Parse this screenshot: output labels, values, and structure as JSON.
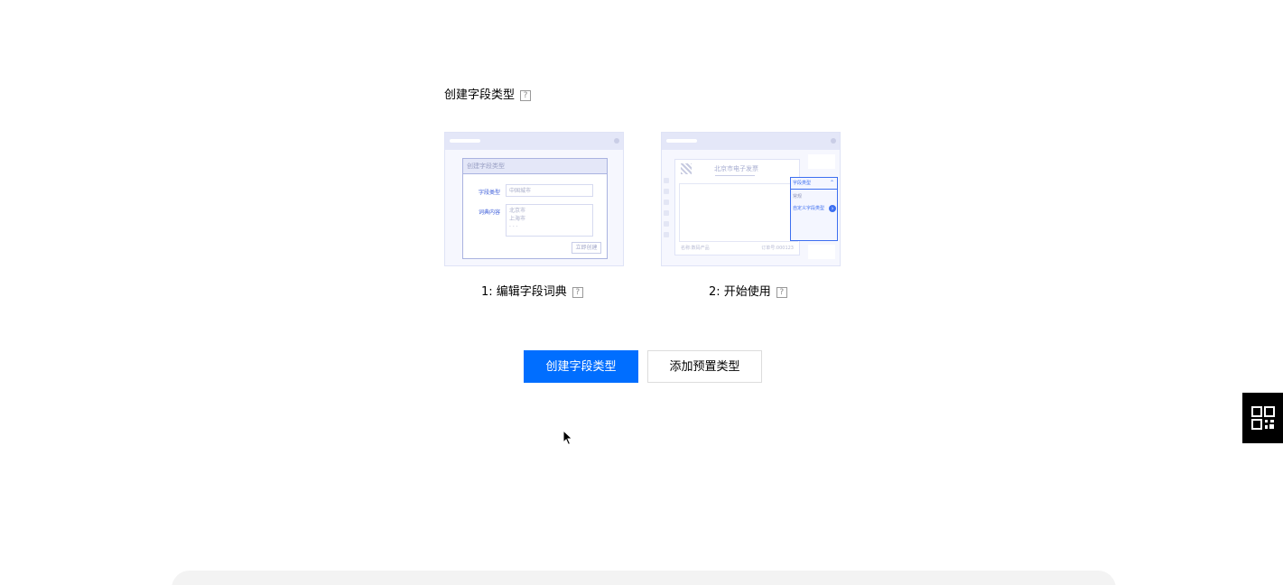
{
  "section": {
    "title": "创建字段类型",
    "help": "?"
  },
  "card1": {
    "dialog_title": "创建字段类型",
    "field_type_label": "字段类型",
    "field_type_value": "中国城市",
    "dict_label": "词典内容",
    "dict_items": [
      "北京市",
      "上海市",
      "· · ·"
    ],
    "create_button": "立即创建"
  },
  "card2": {
    "invoice_title": "北京市电子发票",
    "invoice_footer_left": "名称:数码产品",
    "invoice_footer_right": "订单号:000123",
    "dropdown_head": "字段类型",
    "dropdown_option_1": "常规",
    "dropdown_option_2": "自定义字段类型"
  },
  "steps": [
    {
      "label": "1:  编辑字段词典",
      "help": "?"
    },
    {
      "label": "2:  开始使用",
      "help": "?"
    }
  ],
  "actions": {
    "primary_label": "创建字段类型",
    "secondary_label": "添加预置类型"
  },
  "icons": {
    "help": "help-icon",
    "float": "qrcode-icon",
    "cursor": "cursor-icon"
  },
  "colors": {
    "primary": "#006eff",
    "accent_blue": "#3d6ff0"
  }
}
